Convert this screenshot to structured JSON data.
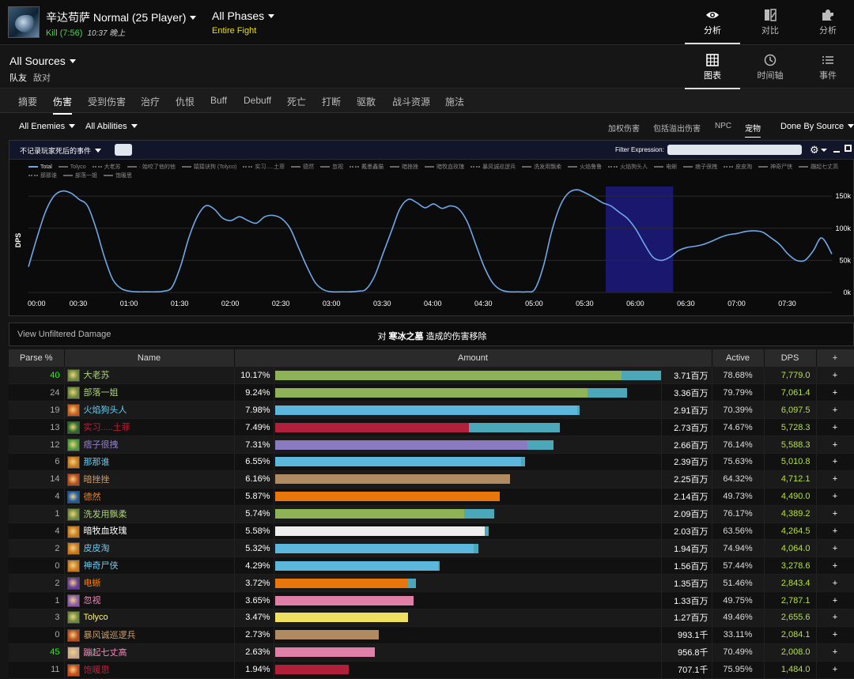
{
  "header": {
    "encounter_title": "辛达苟萨 Normal (25 Player)",
    "kill": "Kill (7:56)",
    "time": "10:37 晚上",
    "phase_title": "All Phases",
    "phase_sub": "Entire Fight"
  },
  "top_nav": [
    {
      "label": "分析",
      "icon": "eye-icon",
      "active": true
    },
    {
      "label": "对比",
      "icon": "compare-icon",
      "active": false
    },
    {
      "label": "分析",
      "icon": "puzzle-icon",
      "active": false
    }
  ],
  "view_nav": [
    {
      "label": "图表",
      "icon": "grid-icon",
      "active": true
    },
    {
      "label": "时间轴",
      "icon": "clock-icon",
      "active": false
    },
    {
      "label": "事件",
      "icon": "list-icon",
      "active": false
    }
  ],
  "sources": {
    "title": "All Sources",
    "friendly": "队友",
    "enemy": "敌对"
  },
  "tabs": [
    {
      "label": "摘要",
      "active": false
    },
    {
      "label": "伤害",
      "active": true
    },
    {
      "label": "受到伤害",
      "active": false
    },
    {
      "label": "治疗",
      "active": false
    },
    {
      "label": "仇恨",
      "active": false
    },
    {
      "label": "Buff",
      "active": false
    },
    {
      "label": "Debuff",
      "active": false
    },
    {
      "label": "死亡",
      "active": false
    },
    {
      "label": "打断",
      "active": false
    },
    {
      "label": "驱散",
      "active": false
    },
    {
      "label": "战斗资源",
      "active": false
    },
    {
      "label": "施法",
      "active": false
    }
  ],
  "filters": {
    "enemies": "All Enemies",
    "abilities": "All Abilities",
    "weighted": "加权伤害",
    "overkill": "包括溢出伤害",
    "npc": "NPC",
    "pets": "宠物",
    "done_by": "Done By Source"
  },
  "chart_bar": {
    "exclude_deaths": "不记录玩家死后的事件",
    "filter_label": "Filter Expression:"
  },
  "chart_data": {
    "type": "line",
    "ylabel": "DPS",
    "y_ticks": [
      "0k",
      "50k",
      "100k",
      "150k"
    ],
    "ylim": [
      0,
      165000
    ],
    "x_ticks": [
      "00:00",
      "00:30",
      "01:00",
      "01:30",
      "02:00",
      "02:30",
      "03:00",
      "03:30",
      "04:00",
      "04:30",
      "05:00",
      "05:30",
      "06:00",
      "06:30",
      "07:00",
      "07:30"
    ],
    "xlim_seconds": [
      0,
      476
    ],
    "highlight_range_seconds": [
      342,
      382
    ],
    "legend": [
      "Total",
      "Tolyco",
      "大老苏",
      "· 始咬了他的他",
      "猿猿诀狗 (Tolyco)",
      "实习.....土菲",
      "德然",
      "忽视",
      "戴墨鑫猫",
      "暗挫挫",
      "暗牧血玫瑰",
      "暴风诚巡逻兵",
      "洗发用飘柔",
      "火焰鲁鲁",
      "火焰狗头人",
      "电蜥",
      "痞子很拽",
      "皮皮淘",
      "神奇尸侠",
      "蹦起七丈高",
      "那那谁",
      "部落一姐",
      "饱暖思"
    ],
    "series": [
      {
        "name": "Total",
        "color": "#6fa8e8",
        "x": [
          0,
          5,
          10,
          15,
          20,
          25,
          30,
          35,
          40,
          45,
          50,
          55,
          60,
          65,
          70,
          75,
          80,
          85,
          90,
          95,
          100,
          105,
          110,
          115,
          120,
          125,
          130,
          135,
          140,
          145,
          150,
          155,
          160,
          165,
          170,
          175,
          180,
          185,
          190,
          195,
          200,
          205,
          210,
          215,
          220,
          225,
          230,
          235,
          240,
          245,
          250,
          255,
          260,
          265,
          270,
          275,
          280,
          285,
          290,
          295,
          300,
          305,
          310,
          315,
          320,
          325,
          330,
          335,
          340,
          345,
          350,
          355,
          360,
          365,
          370,
          375,
          380,
          385,
          390,
          395,
          400,
          405,
          410,
          415,
          420,
          425,
          430,
          435,
          440,
          445,
          450,
          455,
          460,
          465,
          470,
          476
        ],
        "y": [
          40000,
          85000,
          125000,
          150000,
          158000,
          155000,
          145000,
          135000,
          100000,
          55000,
          20000,
          6000,
          2000,
          1000,
          1000,
          1000,
          2000,
          8000,
          40000,
          85000,
          118000,
          135000,
          130000,
          116000,
          112000,
          118000,
          112000,
          108000,
          118000,
          120000,
          115000,
          100000,
          70000,
          40000,
          15000,
          4000,
          1000,
          1000,
          1000,
          2000,
          5000,
          25000,
          60000,
          95000,
          130000,
          145000,
          140000,
          132000,
          138000,
          131000,
          135000,
          130000,
          110000,
          75000,
          40000,
          15000,
          4000,
          1000,
          1000,
          1000,
          5000,
          40000,
          95000,
          135000,
          155000,
          160000,
          155000,
          148000,
          140000,
          135000,
          125000,
          115000,
          98000,
          75000,
          55000,
          50000,
          55000,
          65000,
          70000,
          72000,
          75000,
          80000,
          86000,
          90000,
          92000,
          95000,
          96000,
          94000,
          85000,
          75000,
          60000,
          50000,
          50000,
          65000,
          85000,
          60000
        ]
      }
    ]
  },
  "removal": {
    "link": "View Unfiltered Damage",
    "prefix": "对",
    "target": "寒冰之墓",
    "suffix": "造成的伤害移除"
  },
  "table": {
    "headers": {
      "parse": "Parse %",
      "name": "Name",
      "amount": "Amount",
      "active": "Active",
      "dps": "DPS",
      "plus": "+"
    },
    "rows": [
      {
        "parse": "40",
        "parse_color": "#1eff00",
        "name": "大老苏",
        "name_color": "#abd473",
        "icon_color": "#6a8a3a",
        "pct": "10.17%",
        "amount": "3.71百万",
        "active": "78.68%",
        "dps": "7,779.0",
        "bar_color": "#8db356",
        "frac": 0.893,
        "tail": 0.107
      },
      {
        "parse": "24",
        "parse_color": "#aaaaaa",
        "name": "部落一姐",
        "name_color": "#abd473",
        "icon_color": "#6a8a3a",
        "pct": "9.24%",
        "amount": "3.36百万",
        "active": "79.79%",
        "dps": "7,061.4",
        "bar_color": "#8db356",
        "frac": 0.807,
        "tail": 0.103
      },
      {
        "parse": "19",
        "parse_color": "#aaaaaa",
        "name": "火焰狗头人",
        "name_color": "#69ccf0",
        "icon_color": "#c85a1a",
        "pct": "7.98%",
        "amount": "2.91百万",
        "active": "70.39%",
        "dps": "6,097.5",
        "bar_color": "#5bb8dc",
        "frac": 0.78,
        "tail": 0.006
      },
      {
        "parse": "13",
        "parse_color": "#aaaaaa",
        "name": "实习.....土菲",
        "name_color": "#c41f3b",
        "icon_color": "#2a6a2a",
        "pct": "7.49%",
        "amount": "2.73百万",
        "active": "74.67%",
        "dps": "5,728.3",
        "bar_color": "#b0203a",
        "frac": 0.5,
        "tail": 0.235
      },
      {
        "parse": "12",
        "parse_color": "#aaaaaa",
        "name": "痞子很拽",
        "name_color": "#9482c9",
        "icon_color": "#4a9a3a",
        "pct": "7.31%",
        "amount": "2.66百万",
        "active": "76.14%",
        "dps": "5,588.3",
        "bar_color": "#8a7ac0",
        "frac": 0.65,
        "tail": 0.068
      },
      {
        "parse": "6",
        "parse_color": "#aaaaaa",
        "name": "那那谁",
        "name_color": "#69ccf0",
        "icon_color": "#c8781a",
        "pct": "6.55%",
        "amount": "2.39百万",
        "active": "75.63%",
        "dps": "5,010.8",
        "bar_color": "#5bb8dc",
        "frac": 0.634,
        "tail": 0.011
      },
      {
        "parse": "14",
        "parse_color": "#aaaaaa",
        "name": "暗挫挫",
        "name_color": "#c79c6e",
        "icon_color": "#b84a1a",
        "pct": "6.16%",
        "amount": "2.25百万",
        "active": "64.32%",
        "dps": "4,712.1",
        "bar_color": "#b08a60",
        "frac": 0.607,
        "tail": 0
      },
      {
        "parse": "4",
        "parse_color": "#aaaaaa",
        "name": "德然",
        "name_color": "#ff7d0a",
        "icon_color": "#1a5aa8",
        "pct": "5.87%",
        "amount": "2.14百万",
        "active": "49.73%",
        "dps": "4,490.0",
        "bar_color": "#e8760a",
        "frac": 0.579,
        "tail": 0
      },
      {
        "parse": "1",
        "parse_color": "#aaaaaa",
        "name": "洗发用飘柔",
        "name_color": "#abd473",
        "icon_color": "#6a8a3a",
        "pct": "5.74%",
        "amount": "2.09百万",
        "active": "76.17%",
        "dps": "4,389.2",
        "bar_color": "#8db356",
        "frac": 0.488,
        "tail": 0.077
      },
      {
        "parse": "4",
        "parse_color": "#aaaaaa",
        "name": "暗牧血玫瑰",
        "name_color": "#ffffff",
        "icon_color": "#c8781a",
        "pct": "5.58%",
        "amount": "2.03百万",
        "active": "63.56%",
        "dps": "4,264.5",
        "bar_color": "#eeeeee",
        "frac": 0.541,
        "tail": 0.011
      },
      {
        "parse": "2",
        "parse_color": "#aaaaaa",
        "name": "皮皮淘",
        "name_color": "#69ccf0",
        "icon_color": "#c8781a",
        "pct": "5.32%",
        "amount": "1.94百万",
        "active": "74.94%",
        "dps": "4,064.0",
        "bar_color": "#5bb8dc",
        "frac": 0.512,
        "tail": 0.012
      },
      {
        "parse": "0",
        "parse_color": "#aaaaaa",
        "name": "神奇尸侠",
        "name_color": "#69ccf0",
        "icon_color": "#c8781a",
        "pct": "4.29%",
        "amount": "1.56百万",
        "active": "57.44%",
        "dps": "3,278.6",
        "bar_color": "#5bb8dc",
        "frac": 0.42,
        "tail": 0.004
      },
      {
        "parse": "2",
        "parse_color": "#aaaaaa",
        "name": "电蜥",
        "name_color": "#ff7d0a",
        "icon_color": "#6a3a9a",
        "pct": "3.72%",
        "amount": "1.35百万",
        "active": "51.46%",
        "dps": "2,843.4",
        "bar_color": "#e8760a",
        "frac": 0.343,
        "tail": 0.021
      },
      {
        "parse": "1",
        "parse_color": "#aaaaaa",
        "name": "忽视",
        "name_color": "#f58cba",
        "icon_color": "#8a5aa8",
        "pct": "3.65%",
        "amount": "1.33百万",
        "active": "49.75%",
        "dps": "2,787.1",
        "bar_color": "#e080a8",
        "frac": 0.358,
        "tail": 0
      },
      {
        "parse": "3",
        "parse_color": "#aaaaaa",
        "name": "Tolyco",
        "name_color": "#fff569",
        "icon_color": "#6a8a3a",
        "pct": "3.47%",
        "amount": "1.27百万",
        "active": "49.46%",
        "dps": "2,655.6",
        "bar_color": "#f0e060",
        "frac": 0.342,
        "tail": 0
      },
      {
        "parse": "0",
        "parse_color": "#aaaaaa",
        "name": "暴风诚巡逻兵",
        "name_color": "#c79c6e",
        "icon_color": "#b84a1a",
        "pct": "2.73%",
        "amount": "993.1千",
        "active": "33.11%",
        "dps": "2,084.1",
        "bar_color": "#b08a60",
        "frac": 0.267,
        "tail": 0
      },
      {
        "parse": "45",
        "parse_color": "#1eff00",
        "name": "蹦起七丈高",
        "name_color": "#f58cba",
        "icon_color": "#c8a890",
        "pct": "2.63%",
        "amount": "956.8千",
        "active": "70.49%",
        "dps": "2,008.0",
        "bar_color": "#e080a8",
        "frac": 0.257,
        "tail": 0
      },
      {
        "parse": "11",
        "parse_color": "#aaaaaa",
        "name": "饱暖思",
        "name_color": "#c41f3b",
        "icon_color": "#c84a1a",
        "pct": "1.94%",
        "amount": "707.1千",
        "active": "75.95%",
        "dps": "1,484.0",
        "bar_color": "#b0203a",
        "frac": 0.19,
        "tail": 0
      }
    ]
  }
}
